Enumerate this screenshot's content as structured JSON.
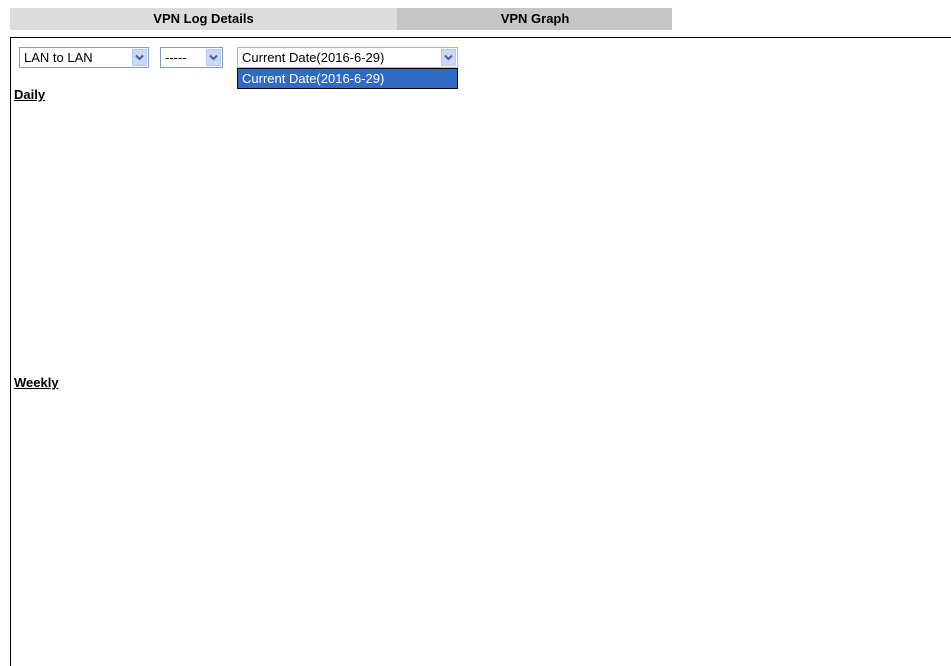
{
  "tabs": [
    {
      "label": "VPN Log Details"
    },
    {
      "label": "VPN Graph"
    }
  ],
  "filters": {
    "type_select": {
      "value": "LAN to LAN"
    },
    "name_select": {
      "value": "-----"
    },
    "date_select": {
      "value": "Current Date(2016-6-29)",
      "options": [
        "Current Date(2016-6-29)"
      ],
      "expanded": true
    }
  },
  "sections": {
    "daily_title": "Daily",
    "weekly_title": "Weekly"
  },
  "icons": {
    "dropdown_arrow": "chevron-down-icon"
  },
  "colors": {
    "tab_active": "#dcdcdc",
    "tab_inactive": "#c6c6c6",
    "selected_option": "#316ac5",
    "focus_border": "#e3b448"
  }
}
